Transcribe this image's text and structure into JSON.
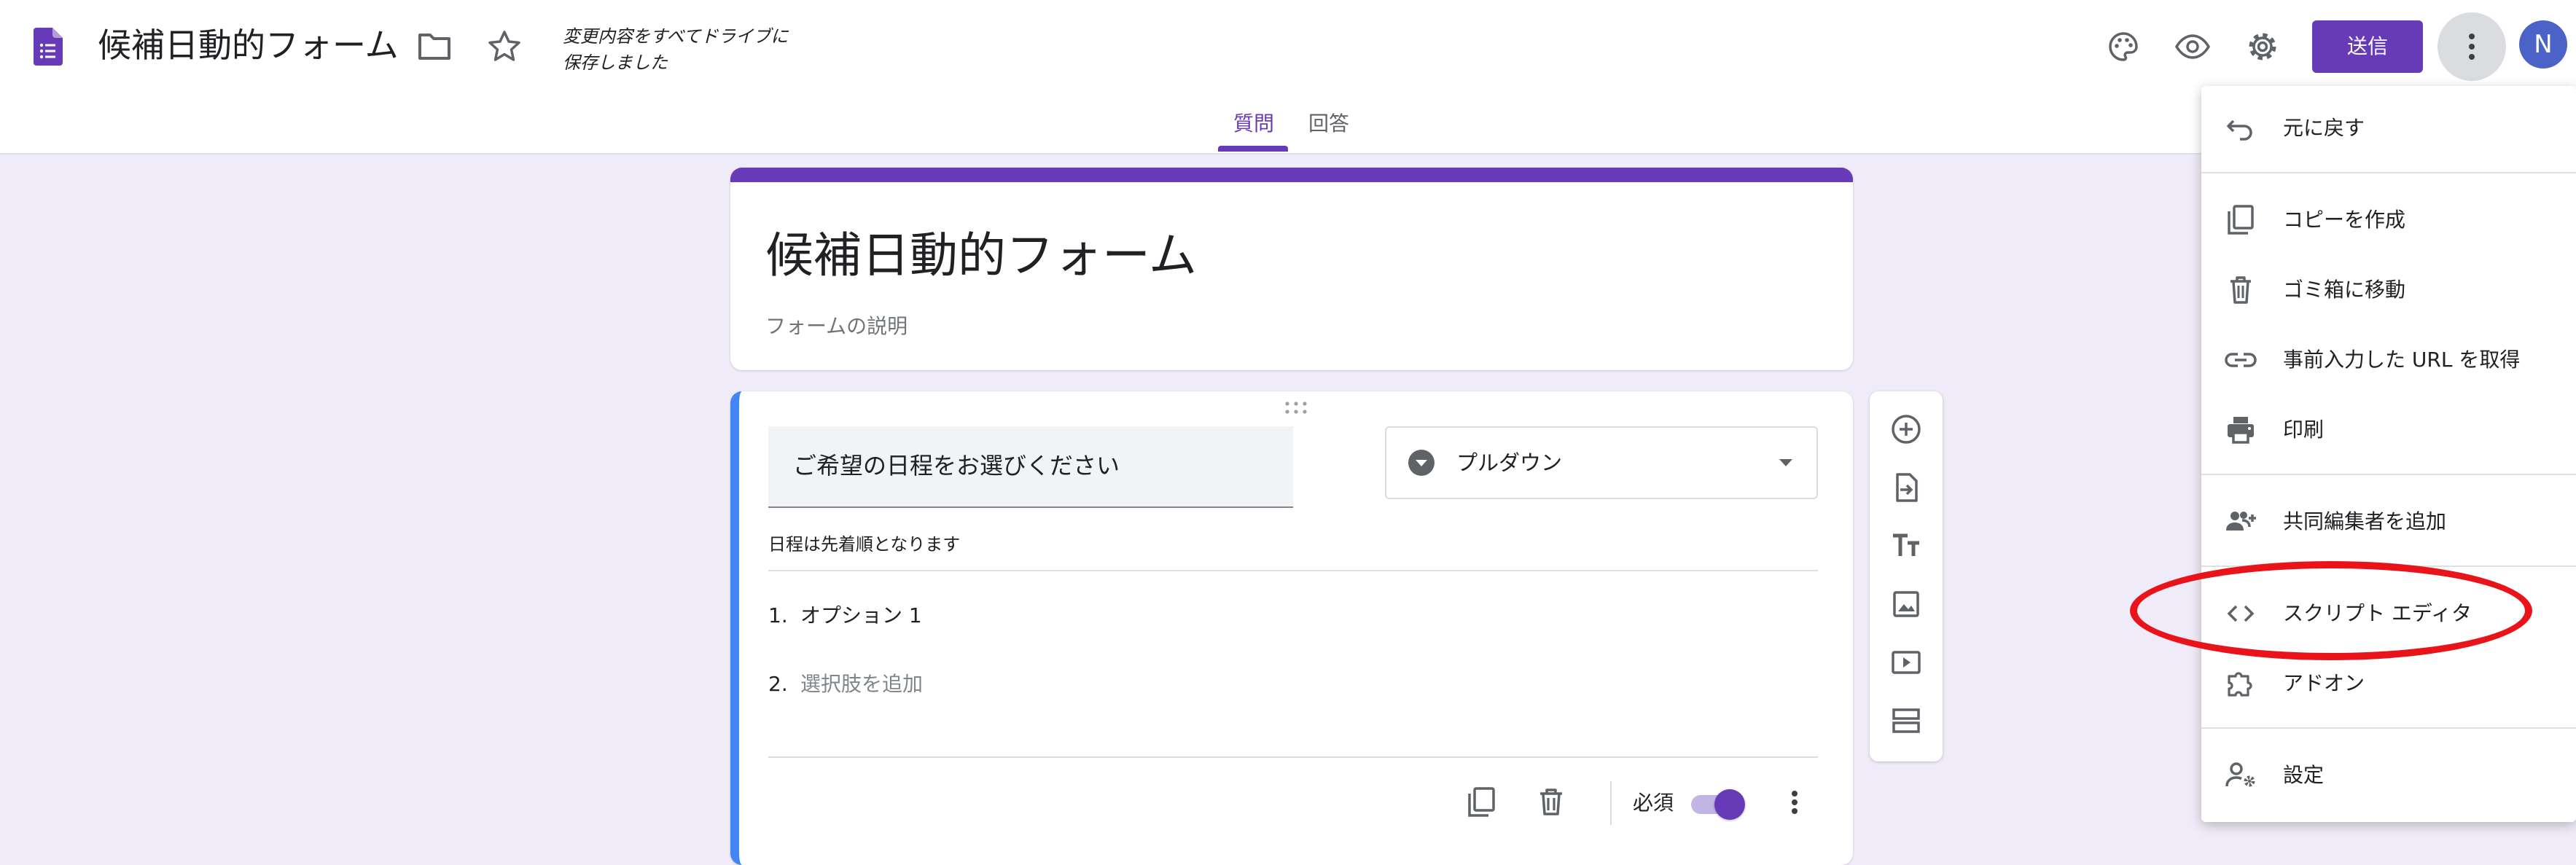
{
  "header": {
    "doc_title": "候補日動的フォーム",
    "save_status": "変更内容をすべてドライブに\n保存しました",
    "send_label": "送信",
    "avatar_initial": "N",
    "tabs": [
      {
        "label": "質問"
      },
      {
        "label": "回答"
      }
    ],
    "active_tab": "質問"
  },
  "form": {
    "title": "候補日動的フォーム",
    "description_placeholder": "フォームの説明",
    "question": {
      "title": "ご希望の日程をお選びください",
      "type_label": "プルダウン",
      "description": "日程は先着順となります",
      "options": [
        {
          "num": "1.",
          "text": "オプション 1"
        },
        {
          "num": "2.",
          "text": "選択肢を追加"
        }
      ],
      "required_label": "必須",
      "required": true
    }
  },
  "menu": {
    "items": [
      {
        "label": "元に戻す",
        "icon": "undo-icon"
      },
      {
        "label": "コピーを作成",
        "icon": "copy-icon"
      },
      {
        "label": "ゴミ箱に移動",
        "icon": "trash-icon"
      },
      {
        "label": "事前入力した URL を取得",
        "icon": "link-icon"
      },
      {
        "label": "印刷",
        "icon": "print-icon"
      },
      {
        "label": "共同編集者を追加",
        "icon": "add-people-icon"
      },
      {
        "label": "スクリプト エディタ",
        "icon": "code-icon"
      },
      {
        "label": "アドオン",
        "icon": "puzzle-icon"
      },
      {
        "label": "設定",
        "icon": "person-settings-icon"
      }
    ]
  },
  "colors": {
    "accent": "#673ab7",
    "background": "#f0ebf8",
    "question_accent": "#4285f4",
    "annotation": "#e8141a"
  }
}
